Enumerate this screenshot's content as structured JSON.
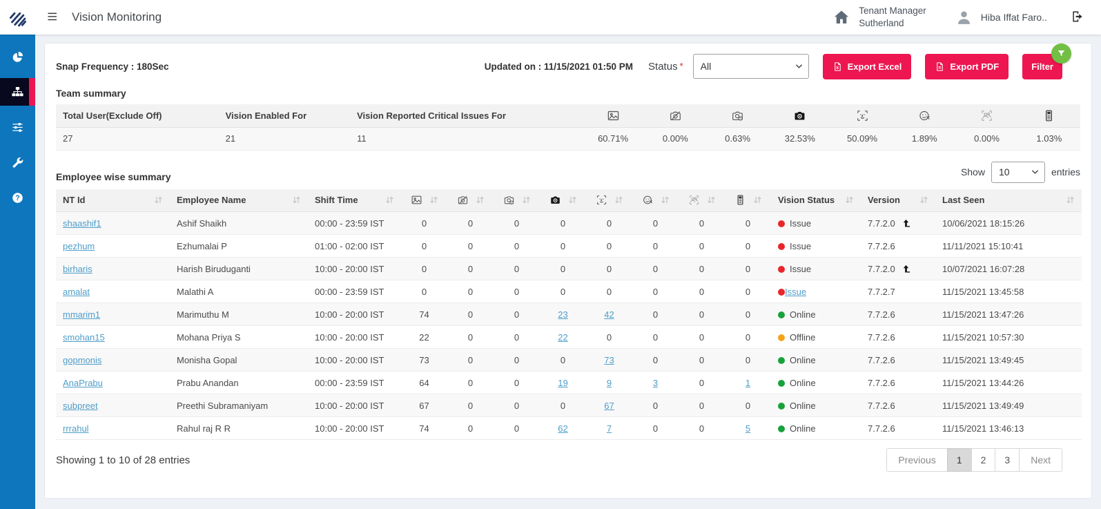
{
  "header": {
    "title": "Vision Monitoring",
    "tenant_line1": "Tenant Manager",
    "tenant_line2": "Sutherland",
    "user_name": "Hiba Iffat Faro.."
  },
  "sidebar": {
    "items": [
      {
        "name": "dashboard",
        "icon": "pie-chart-icon",
        "active": false
      },
      {
        "name": "team-monitoring",
        "icon": "sitemap-icon",
        "active": true
      },
      {
        "name": "preferences",
        "icon": "sliders-icon",
        "active": false
      },
      {
        "name": "tools",
        "icon": "wrench-icon",
        "active": false
      },
      {
        "name": "help",
        "icon": "help-icon",
        "active": false
      }
    ]
  },
  "toolbar": {
    "snap_frequency": "Snap Frequency : 180Sec",
    "updated_on": "Updated on : 11/15/2021 01:50 PM",
    "status_label": "Status",
    "status_required": "*",
    "status_value": "All",
    "export_excel": "Export Excel",
    "export_pdf": "Export PDF",
    "filter": "Filter"
  },
  "metric_icons": [
    "image-icon",
    "camera-off-icon",
    "camera-alert-icon",
    "camera-covered-icon",
    "face-scan-icon",
    "face-mismatch-icon",
    "multiple-persons-icon",
    "mobile-phone-icon"
  ],
  "team_summary": {
    "title": "Team summary",
    "text_headers": [
      "Total User(Exclude Off)",
      "Vision Enabled For",
      "Vision Reported Critical Issues For"
    ],
    "text_values": [
      "27",
      "21",
      "11"
    ],
    "icon_values": [
      "60.71%",
      "0.00%",
      "0.63%",
      "32.53%",
      "50.09%",
      "1.89%",
      "0.00%",
      "1.03%"
    ]
  },
  "employee_summary": {
    "title": "Employee wise summary",
    "show_label": "Show",
    "page_size": "10",
    "entries_label": "entries",
    "text_headers": [
      "NT Id",
      "Employee Name",
      "Shift Time"
    ],
    "tail_headers": [
      "Vision Status",
      "Version",
      "Last Seen"
    ],
    "rows": [
      {
        "nt_id": "shaashif1",
        "name": "Ashif Shaikh",
        "shift": "00:00 - 23:59 IST",
        "counts": [
          "0",
          "0",
          "0",
          "0",
          "0",
          "0",
          "0",
          "0"
        ],
        "count_links": [
          false,
          false,
          false,
          false,
          false,
          false,
          false,
          false
        ],
        "status": "Issue",
        "status_color": "#e8262b",
        "status_link": false,
        "version": "7.7.2.0",
        "upgrade": true,
        "last_seen": "10/06/2021 18:15:26"
      },
      {
        "nt_id": "pezhum",
        "name": "Ezhumalai P",
        "shift": "01:00 - 02:00 IST",
        "counts": [
          "0",
          "0",
          "0",
          "0",
          "0",
          "0",
          "0",
          "0"
        ],
        "count_links": [
          false,
          false,
          false,
          false,
          false,
          false,
          false,
          false
        ],
        "status": "Issue",
        "status_color": "#e8262b",
        "status_link": false,
        "version": "7.7.2.6",
        "upgrade": false,
        "last_seen": "11/11/2021 15:10:41"
      },
      {
        "nt_id": "birharis",
        "name": "Harish Biruduganti",
        "shift": "10:00 - 20:00 IST",
        "counts": [
          "0",
          "0",
          "0",
          "0",
          "0",
          "0",
          "0",
          "0"
        ],
        "count_links": [
          false,
          false,
          false,
          false,
          false,
          false,
          false,
          false
        ],
        "status": "Issue",
        "status_color": "#e8262b",
        "status_link": false,
        "version": "7.7.2.0",
        "upgrade": true,
        "last_seen": "10/07/2021 16:07:28"
      },
      {
        "nt_id": "amalat",
        "name": "Malathi A",
        "shift": "00:00 - 23:59 IST",
        "counts": [
          "0",
          "0",
          "0",
          "0",
          "0",
          "0",
          "0",
          "0"
        ],
        "count_links": [
          false,
          false,
          false,
          false,
          false,
          false,
          false,
          false
        ],
        "status": "Issue",
        "status_color": "#e8262b",
        "status_link": true,
        "version": "7.7.2.7",
        "upgrade": false,
        "last_seen": "11/15/2021 13:45:58"
      },
      {
        "nt_id": "mmarim1",
        "name": "Marimuthu M",
        "shift": "10:00 - 20:00 IST",
        "counts": [
          "74",
          "0",
          "0",
          "23",
          "42",
          "0",
          "0",
          "0"
        ],
        "count_links": [
          false,
          false,
          false,
          true,
          true,
          false,
          false,
          false
        ],
        "status": "Online",
        "status_color": "#17a23b",
        "status_link": false,
        "version": "7.7.2.6",
        "upgrade": false,
        "last_seen": "11/15/2021 13:47:26"
      },
      {
        "nt_id": "smohan15",
        "name": "Mohana Priya S",
        "shift": "10:00 - 20:00 IST",
        "counts": [
          "22",
          "0",
          "0",
          "22",
          "0",
          "0",
          "0",
          "0"
        ],
        "count_links": [
          false,
          false,
          false,
          true,
          false,
          false,
          false,
          false
        ],
        "status": "Offline",
        "status_color": "#f7a21a",
        "status_link": false,
        "version": "7.7.2.6",
        "upgrade": false,
        "last_seen": "11/15/2021 10:57:30"
      },
      {
        "nt_id": "gopmonis",
        "name": "Monisha Gopal",
        "shift": "10:00 - 20:00 IST",
        "counts": [
          "73",
          "0",
          "0",
          "0",
          "73",
          "0",
          "0",
          "0"
        ],
        "count_links": [
          false,
          false,
          false,
          false,
          true,
          false,
          false,
          false
        ],
        "status": "Online",
        "status_color": "#17a23b",
        "status_link": false,
        "version": "7.7.2.6",
        "upgrade": false,
        "last_seen": "11/15/2021 13:49:45"
      },
      {
        "nt_id": "AnaPrabu",
        "name": "Prabu Anandan",
        "shift": "00:00 - 23:59 IST",
        "counts": [
          "64",
          "0",
          "0",
          "19",
          "9",
          "3",
          "0",
          "1"
        ],
        "count_links": [
          false,
          false,
          false,
          true,
          true,
          true,
          false,
          true
        ],
        "status": "Online",
        "status_color": "#17a23b",
        "status_link": false,
        "version": "7.7.2.6",
        "upgrade": false,
        "last_seen": "11/15/2021 13:44:26"
      },
      {
        "nt_id": "subpreet",
        "name": "Preethi Subramaniyam",
        "shift": "10:00 - 20:00 IST",
        "counts": [
          "67",
          "0",
          "0",
          "0",
          "67",
          "0",
          "0",
          "0"
        ],
        "count_links": [
          false,
          false,
          false,
          false,
          true,
          false,
          false,
          false
        ],
        "status": "Online",
        "status_color": "#17a23b",
        "status_link": false,
        "version": "7.7.2.6",
        "upgrade": false,
        "last_seen": "11/15/2021 13:49:49"
      },
      {
        "nt_id": "rrrahul",
        "name": "Rahul raj R R",
        "shift": "10:00 - 20:00 IST",
        "counts": [
          "74",
          "0",
          "0",
          "62",
          "7",
          "0",
          "0",
          "5"
        ],
        "count_links": [
          false,
          false,
          false,
          true,
          true,
          false,
          false,
          true
        ],
        "status": "Online",
        "status_color": "#17a23b",
        "status_link": false,
        "version": "7.7.2.6",
        "upgrade": false,
        "last_seen": "11/15/2021 13:46:13"
      }
    ],
    "showing_text": "Showing 1 to 10 of 28 entries",
    "pagination": {
      "previous": "Previous",
      "pages": [
        "1",
        "2",
        "3"
      ],
      "active_page": "1",
      "next": "Next"
    }
  },
  "colors": {
    "accent_crimson": "#ed1651",
    "sidebar_blue": "#0e76bc",
    "badge_green": "#71bf44",
    "link_blue": "#4e9dc8",
    "status_issue": "#e8262b",
    "status_online": "#17a23b",
    "status_offline": "#f7a21a"
  }
}
